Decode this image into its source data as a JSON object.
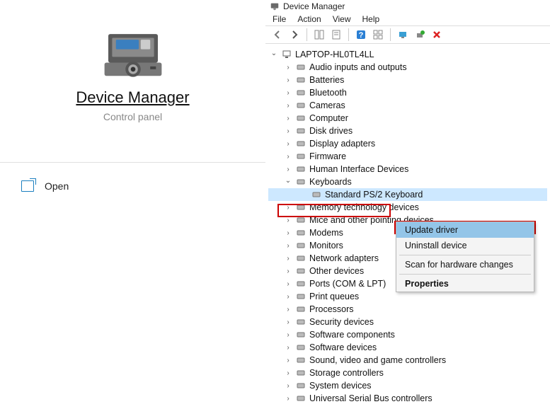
{
  "control_panel": {
    "title": "Device Manager",
    "subtitle": "Control panel",
    "open_label": "Open"
  },
  "device_manager": {
    "window_title": "Device Manager",
    "menu": {
      "file": "File",
      "action": "Action",
      "view": "View",
      "help": "Help"
    },
    "root_node": "LAPTOP-HL0TL4LL",
    "categories": [
      {
        "label": "Audio inputs and outputs",
        "expanded": false
      },
      {
        "label": "Batteries",
        "expanded": false
      },
      {
        "label": "Bluetooth",
        "expanded": false
      },
      {
        "label": "Cameras",
        "expanded": false
      },
      {
        "label": "Computer",
        "expanded": false
      },
      {
        "label": "Disk drives",
        "expanded": false
      },
      {
        "label": "Display adapters",
        "expanded": false
      },
      {
        "label": "Firmware",
        "expanded": false
      },
      {
        "label": "Human Interface Devices",
        "expanded": false
      },
      {
        "label": "Keyboards",
        "expanded": true,
        "highlighted": true,
        "children": [
          {
            "label": "Standard PS/2 Keyboard",
            "selected": true
          }
        ]
      },
      {
        "label": "Memory technology devices",
        "expanded": false
      },
      {
        "label": "Mice and other pointing devices",
        "expanded": false
      },
      {
        "label": "Modems",
        "expanded": false
      },
      {
        "label": "Monitors",
        "expanded": false
      },
      {
        "label": "Network adapters",
        "expanded": false
      },
      {
        "label": "Other devices",
        "expanded": false
      },
      {
        "label": "Ports (COM & LPT)",
        "expanded": false
      },
      {
        "label": "Print queues",
        "expanded": false
      },
      {
        "label": "Processors",
        "expanded": false
      },
      {
        "label": "Security devices",
        "expanded": false
      },
      {
        "label": "Software components",
        "expanded": false
      },
      {
        "label": "Software devices",
        "expanded": false
      },
      {
        "label": "Sound, video and game controllers",
        "expanded": false
      },
      {
        "label": "Storage controllers",
        "expanded": false
      },
      {
        "label": "System devices",
        "expanded": false
      },
      {
        "label": "Universal Serial Bus controllers",
        "expanded": false
      }
    ],
    "context_menu": {
      "update_driver": "Update driver",
      "uninstall_device": "Uninstall device",
      "scan_hardware": "Scan for hardware changes",
      "properties": "Properties"
    }
  }
}
